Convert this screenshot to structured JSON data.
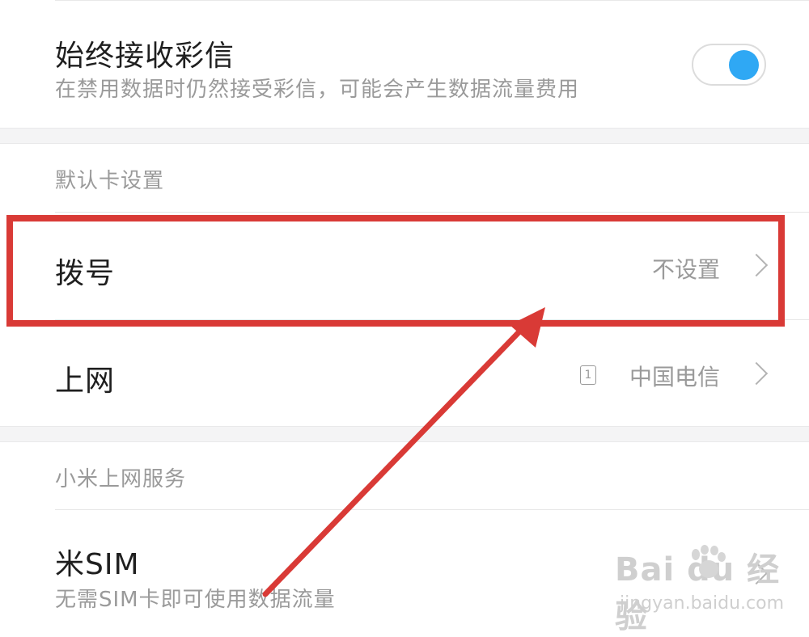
{
  "mms": {
    "title": "始终接收彩信",
    "subtitle": "在禁用数据时仍然接受彩信，可能会产生数据流量费用",
    "toggle_on": true,
    "accent": "#2fa8f4"
  },
  "default_card": {
    "header": "默认卡设置",
    "dial": {
      "label": "拨号",
      "value": "不设置"
    },
    "data": {
      "label": "上网",
      "sim_slot": "1",
      "value": "中国电信"
    }
  },
  "mi_service": {
    "header": "小米上网服务",
    "misim": {
      "label": "米SIM",
      "subtitle": "无需SIM卡即可使用数据流量"
    }
  },
  "annotation": {
    "color": "#d93a36"
  },
  "watermark": {
    "brand": "Bai du 经验",
    "url": "jingyan.baidu.com"
  }
}
